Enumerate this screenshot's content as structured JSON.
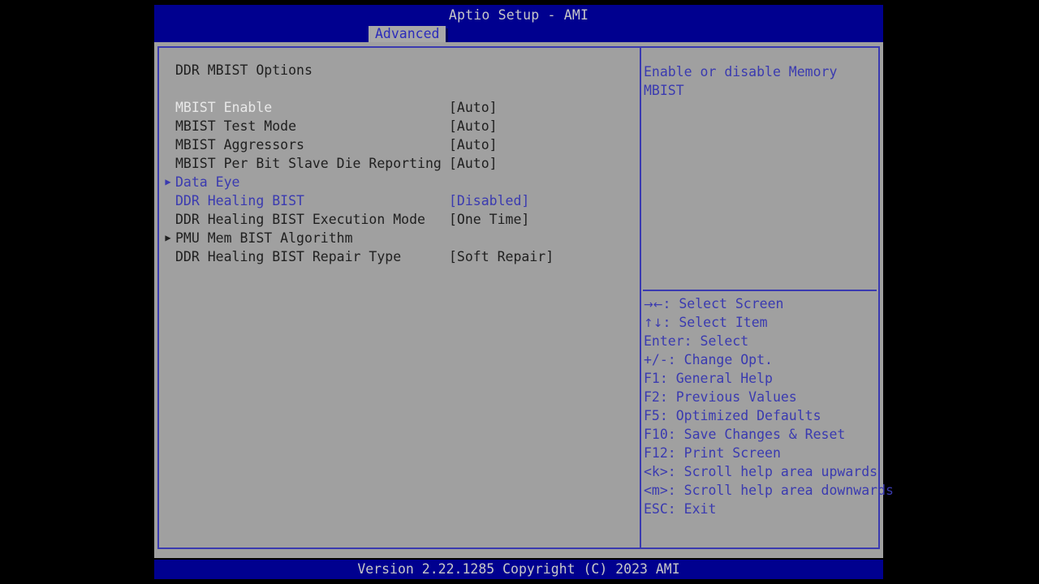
{
  "window": {
    "app_title": "Aptio Setup - AMI",
    "footer": "Version 2.22.1285 Copyright (C) 2023 AMI"
  },
  "tabs": [
    {
      "label": "Advanced",
      "active": true
    }
  ],
  "main": {
    "section_title": "DDR MBIST Options",
    "options": [
      {
        "label": "MBIST Enable",
        "value": "[Auto]",
        "marker": "",
        "color": "light",
        "value_color": "dark",
        "selected": true
      },
      {
        "label": "MBIST Test Mode",
        "value": "[Auto]",
        "marker": "",
        "color": "dark",
        "value_color": "dark",
        "selected": false
      },
      {
        "label": "MBIST Aggressors",
        "value": "[Auto]",
        "marker": "",
        "color": "dark",
        "value_color": "dark",
        "selected": false
      },
      {
        "label": "MBIST Per Bit Slave Die Reporting",
        "value": "[Auto]",
        "marker": "",
        "color": "dark",
        "value_color": "dark",
        "selected": false
      },
      {
        "label": "Data Eye",
        "value": "",
        "marker": "▶",
        "color": "blue",
        "value_color": "blue",
        "selected": false
      },
      {
        "label": "DDR Healing BIST",
        "value": "[Disabled]",
        "marker": "",
        "color": "blue",
        "value_color": "blue",
        "selected": false
      },
      {
        "label": "DDR Healing BIST Execution Mode",
        "value": "[One Time]",
        "marker": "",
        "color": "dark",
        "value_color": "dark",
        "selected": false
      },
      {
        "label": "PMU Mem BIST Algorithm",
        "value": "",
        "marker": "▶",
        "color": "dark",
        "value_color": "dark",
        "selected": false
      },
      {
        "label": "DDR Healing BIST Repair Type",
        "value": "[Soft Repair]",
        "marker": "",
        "color": "dark",
        "value_color": "dark",
        "selected": false
      }
    ]
  },
  "help": {
    "description": "Enable or disable Memory MBIST",
    "keys": [
      {
        "glyph": "→←",
        "text": ": Select Screen"
      },
      {
        "glyph": "↑↓",
        "text": ": Select Item"
      },
      {
        "glyph": "",
        "text": "Enter: Select"
      },
      {
        "glyph": "",
        "text": "+/-: Change Opt."
      },
      {
        "glyph": "",
        "text": "F1: General Help"
      },
      {
        "glyph": "",
        "text": "F2: Previous Values"
      },
      {
        "glyph": "",
        "text": "F5: Optimized Defaults"
      },
      {
        "glyph": "",
        "text": "F10: Save Changes & Reset"
      },
      {
        "glyph": "",
        "text": "F12: Print Screen"
      },
      {
        "glyph": "",
        "text": "<k>: Scroll help area upwards"
      },
      {
        "glyph": "",
        "text": "<m>: Scroll help area downwards"
      },
      {
        "glyph": "",
        "text": "ESC: Exit"
      }
    ]
  },
  "colors": {
    "header_blue": "#00008f",
    "panel_gray": "#a0a0a0",
    "accent_blue": "#3a3ab0",
    "text_dark": "#202020",
    "text_light": "#e8e8e8",
    "footer_text": "#c8c8c8"
  }
}
